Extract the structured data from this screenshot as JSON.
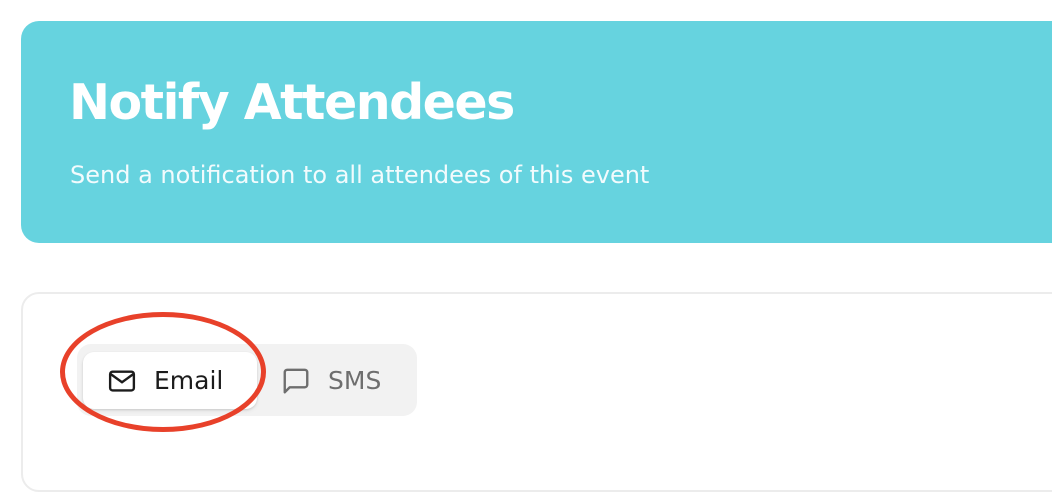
{
  "header": {
    "title": "Notify Attendees",
    "subtitle": "Send a notification to all attendees of this event",
    "background_color": "#66d3df"
  },
  "notification_tabs": {
    "selected": "Email",
    "items": [
      {
        "label": "Email",
        "icon": "mail-icon",
        "active": true
      },
      {
        "label": "SMS",
        "icon": "message-square-icon",
        "active": false
      }
    ]
  },
  "annotation": {
    "type": "circle-highlight",
    "target": "Email",
    "color": "#e8412a"
  }
}
